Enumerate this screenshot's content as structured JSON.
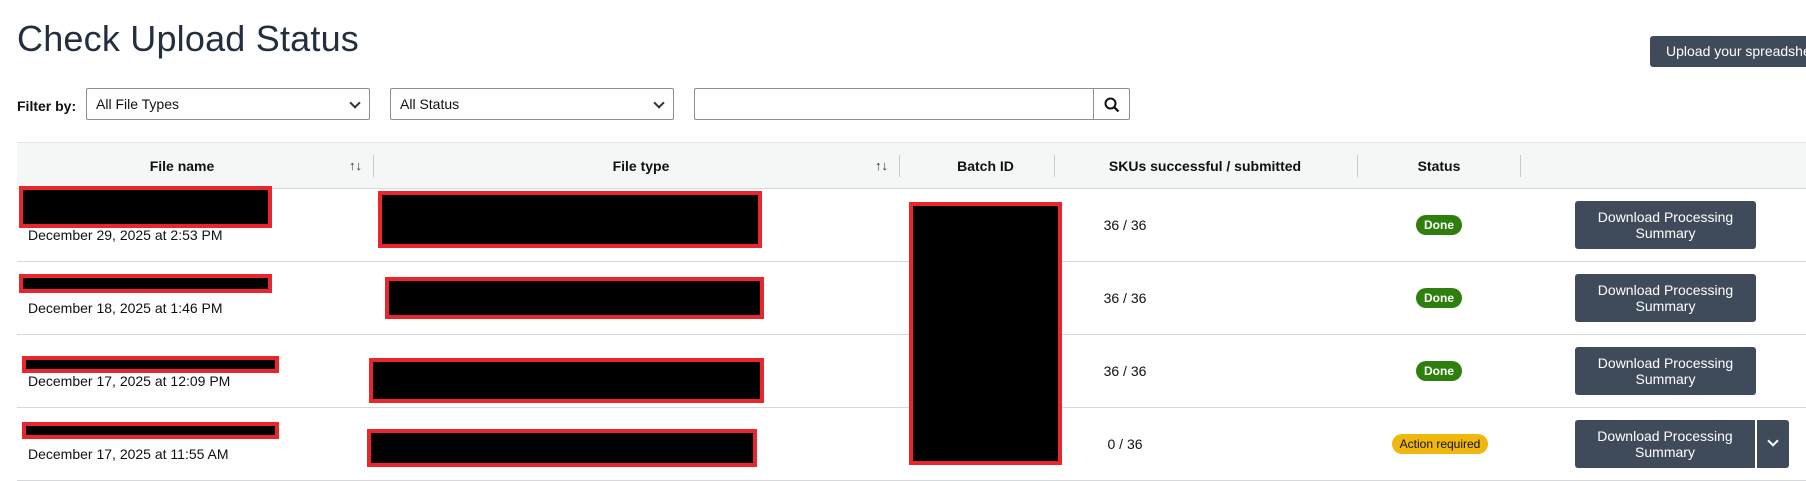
{
  "page": {
    "title": "Check Upload Status"
  },
  "header": {
    "upload_button_label": "Upload your spreadsheet"
  },
  "filters": {
    "label": "Filter by:",
    "file_type_selected": "All File Types",
    "status_selected": "All Status",
    "search_value": "",
    "search_icon": "search-icon"
  },
  "table": {
    "columns": {
      "file_name": "File name",
      "file_type": "File type",
      "batch_id": "Batch ID",
      "skus": "SKUs successful / submitted",
      "status": "Status",
      "actions": ""
    },
    "rows": [
      {
        "date": "December 29, 2025 at 2:53 PM",
        "skus": "36 / 36",
        "status": "Done",
        "action": "Download Processing Summary"
      },
      {
        "date": "December 18, 2025 at 1:46 PM",
        "skus": "36 / 36",
        "status": "Done",
        "action": "Download Processing Summary"
      },
      {
        "date": "December 17, 2025 at 12:09 PM",
        "skus": "36 / 36",
        "status": "Done",
        "action": "Download Processing Summary"
      },
      {
        "date": "December 17, 2025 at 11:55 AM",
        "skus": "0 / 36",
        "status": "Action required",
        "action": "Download Processing Summary"
      }
    ]
  },
  "colors": {
    "primary_button": "#3f4b5b",
    "done_badge": "#2f7f0e",
    "action_required_badge": "#f0b70f",
    "redaction_border": "#e8262b"
  }
}
